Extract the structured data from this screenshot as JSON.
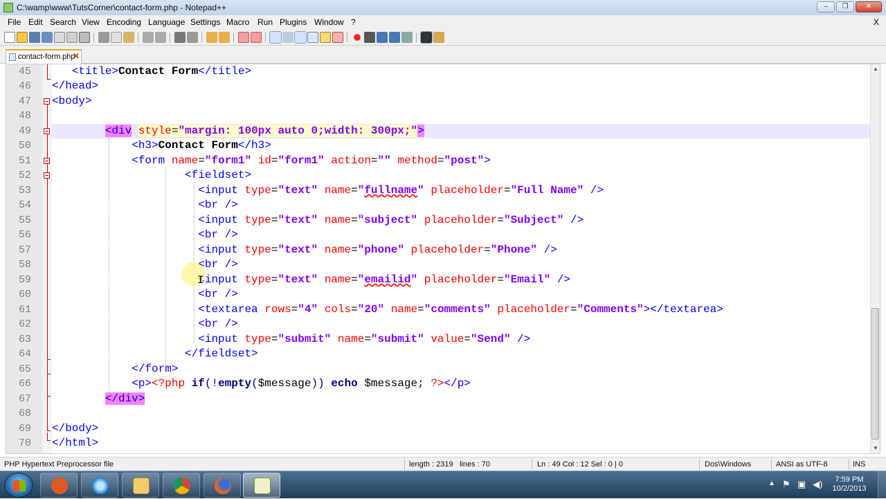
{
  "window": {
    "title": "C:\\wamp\\www\\TutsCorner\\contact-form.php - Notepad++",
    "minimize_label": "‒",
    "maximize_label": "❐",
    "close_label": "✕"
  },
  "menu": {
    "items": [
      "File",
      "Edit",
      "Search",
      "View",
      "Encoding",
      "Language",
      "Settings",
      "Macro",
      "Run",
      "Plugins",
      "Window",
      "?"
    ],
    "close_label": "X"
  },
  "tab": {
    "name": "contact-form.php",
    "close": "✕"
  },
  "editor": {
    "current_line": 49,
    "lines": [
      45,
      46,
      47,
      48,
      49,
      50,
      51,
      52,
      53,
      54,
      55,
      56,
      57,
      58,
      59,
      60,
      61,
      62,
      63,
      64,
      65,
      66,
      67,
      68,
      69,
      70
    ]
  },
  "status": {
    "filetype": "PHP Hypertext Preprocessor file",
    "length": "length : 2319",
    "lines": "lines : 70",
    "position": "Ln : 49    Col : 12    Sel : 0 | 0",
    "eol": "Dos\\Windows",
    "encoding": "ANSI as UTF-8",
    "mode": "INS"
  },
  "taskbar": {
    "apps": [
      "media-player",
      "internet-explorer",
      "file-explorer",
      "chrome",
      "firefox",
      "notepad-plus-plus"
    ],
    "time": "7:59 PM",
    "date": "10/2/2013"
  },
  "colors": {
    "tag": "#0000ff",
    "attribute": "#ff0000",
    "attribute_value": "#8000ff",
    "current_line": "#e8e8ff",
    "brace_match": "#ff80ff",
    "fold_marker": "#cc0000"
  }
}
